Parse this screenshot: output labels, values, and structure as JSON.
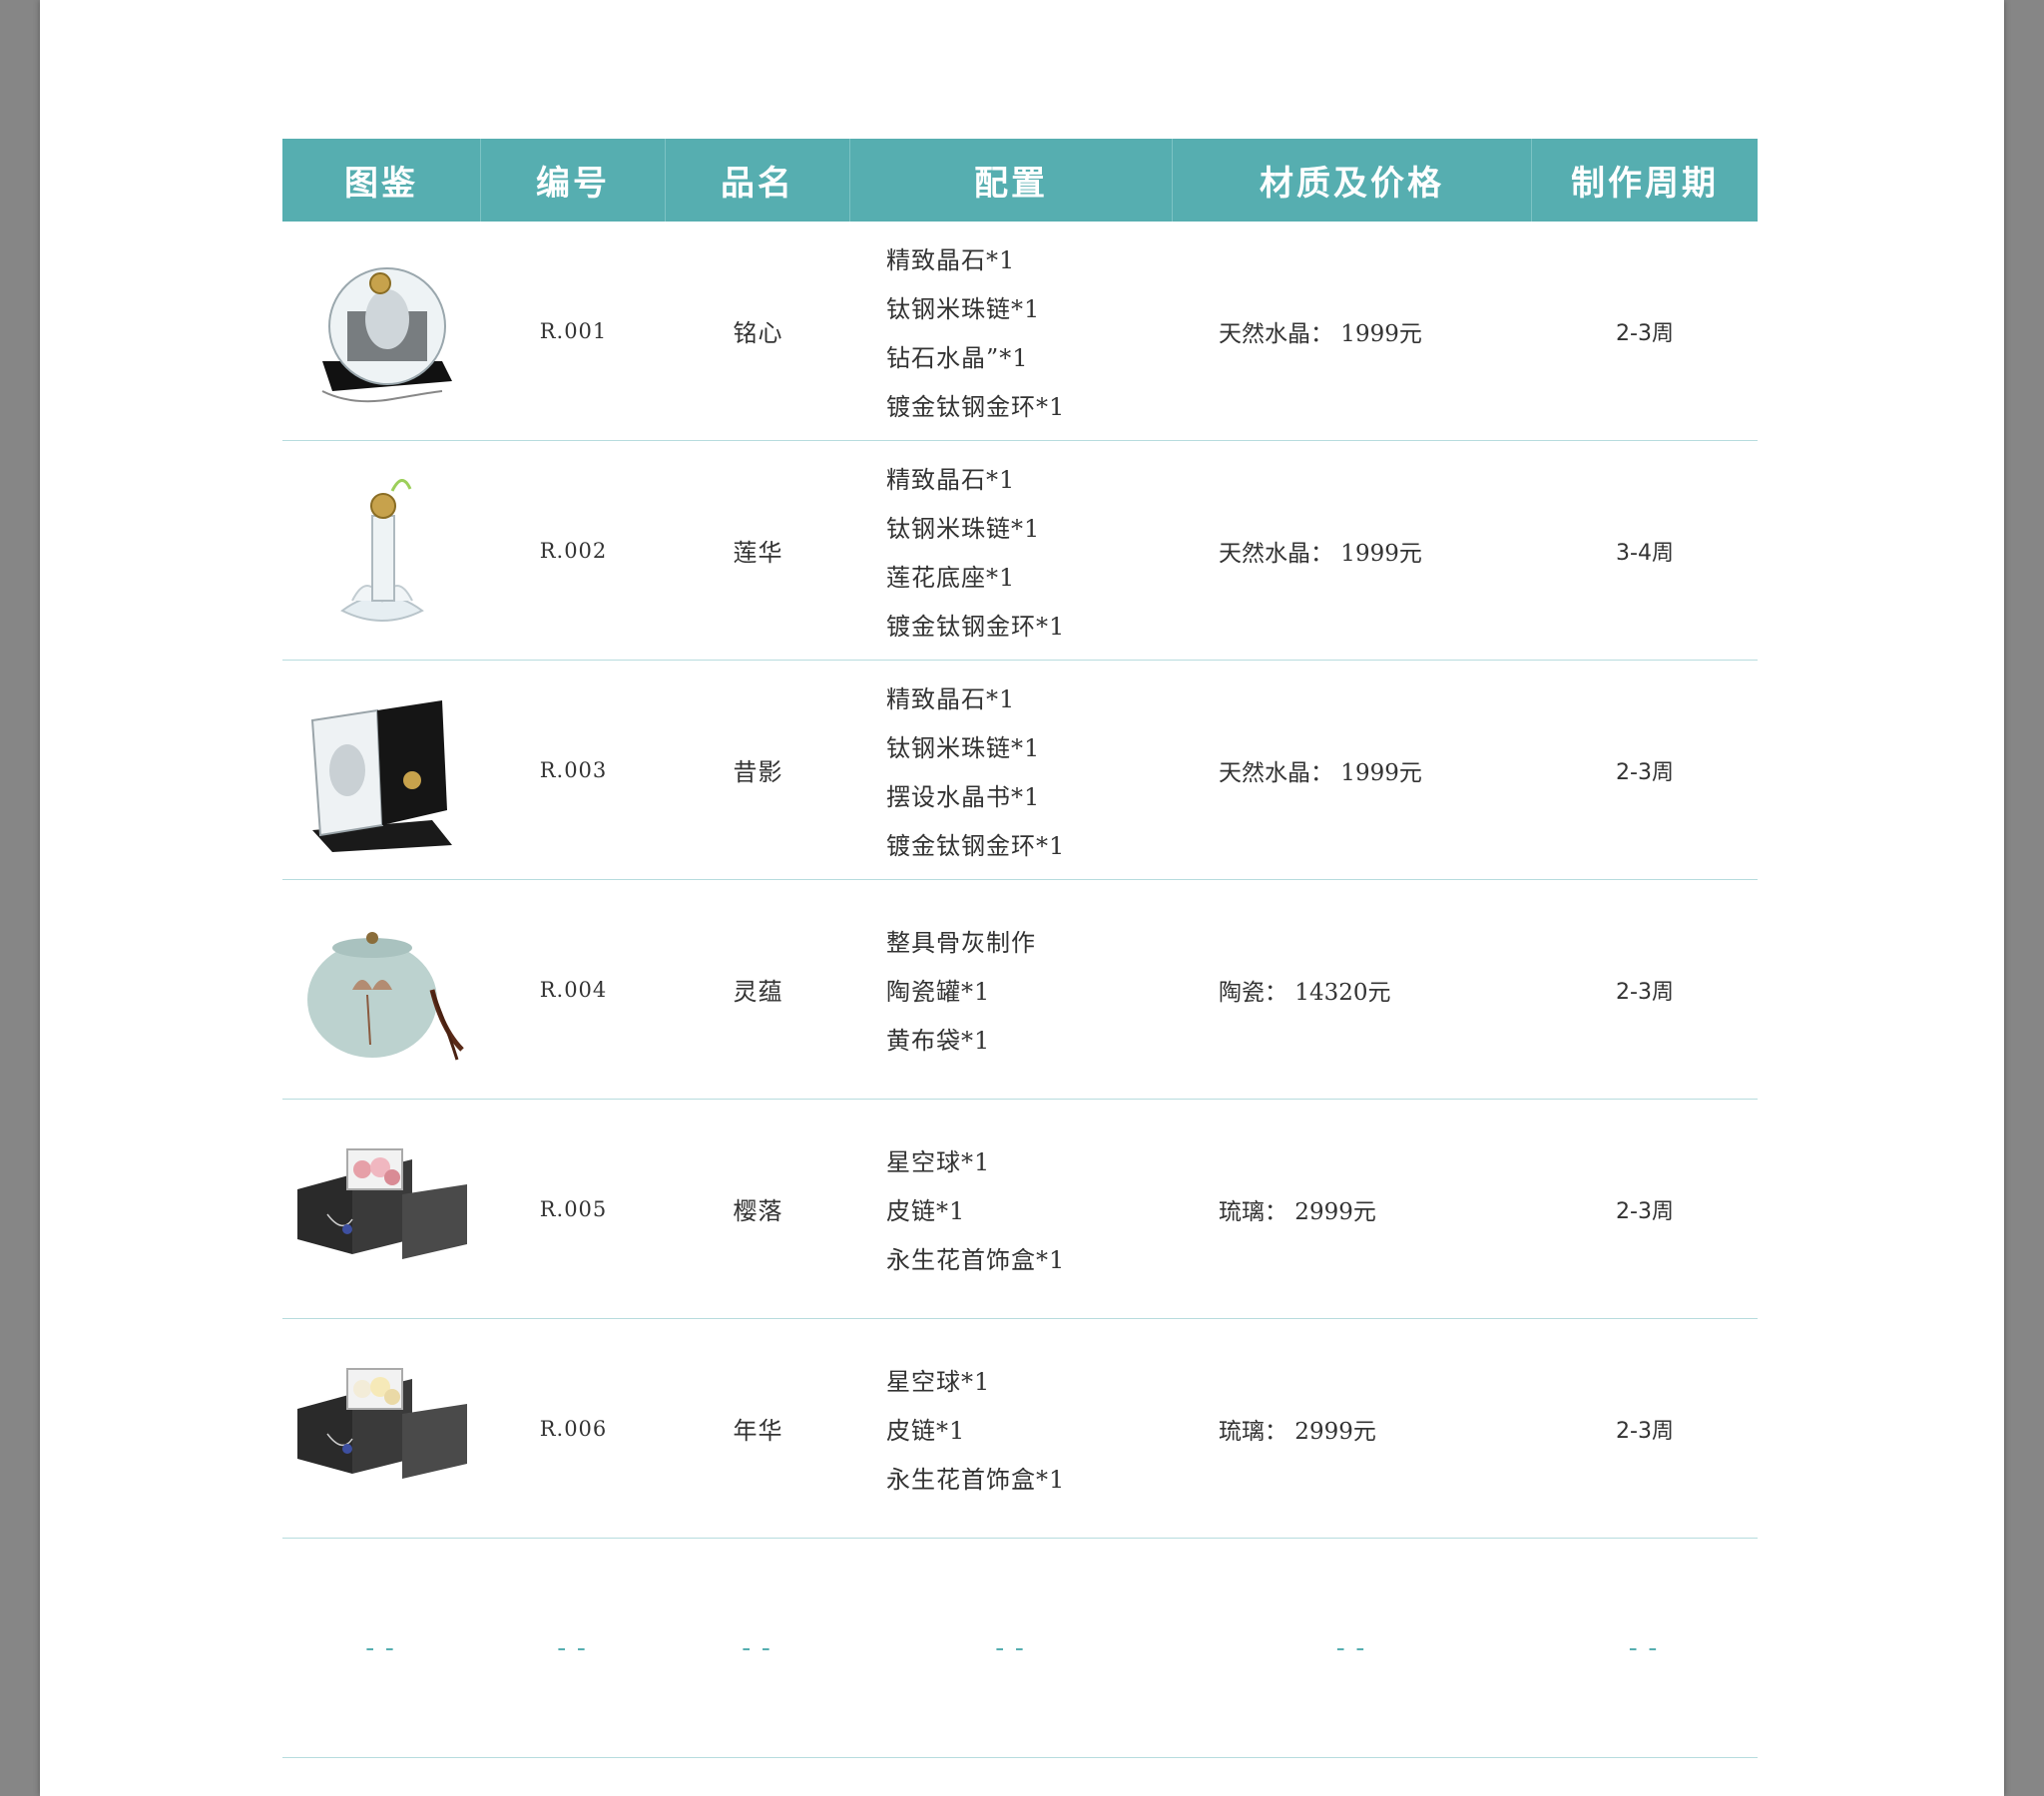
{
  "table": {
    "headers": [
      "图鉴",
      "编号",
      "品名",
      "配置",
      "材质及价格",
      "制作周期"
    ],
    "rows": [
      {
        "thumb_icon": "crystal-sphere-pendant-icon",
        "code": "R.001",
        "name": "铭心",
        "config": [
          "精致晶石*1",
          "钛钢米珠链*1",
          "钻石水晶”*1",
          "镀金钛钢金环*1"
        ],
        "material": "天然水晶： 1999元",
        "period": "2-3周"
      },
      {
        "thumb_icon": "lotus-crystal-stand-icon",
        "code": "R.002",
        "name": "莲华",
        "config": [
          "精致晶石*1",
          "钛钢米珠链*1",
          "莲花底座*1",
          "镀金钛钢金环*1"
        ],
        "material": "天然水晶： 1999元",
        "period": "3-4周"
      },
      {
        "thumb_icon": "crystal-book-display-icon",
        "code": "R.003",
        "name": "昔影",
        "config": [
          "精致晶石*1",
          "钛钢米珠链*1",
          "摆设水晶书*1",
          "镀金钛钢金环*1"
        ],
        "material": "天然水晶： 1999元",
        "period": "2-3周"
      },
      {
        "thumb_icon": "ceramic-jar-icon",
        "code": "R.004",
        "name": "灵蕴",
        "config": [
          "整具骨灰制作",
          "陶瓷罐*1",
          "黄布袋*1"
        ],
        "material": "陶瓷： 14320元",
        "period": "2-3周"
      },
      {
        "thumb_icon": "pink-flower-jewelry-box-icon",
        "code": "R.005",
        "name": "樱落",
        "config": [
          "星空球*1",
          "皮链*1",
          "永生花首饰盒*1"
        ],
        "material": "琉璃： 2999元",
        "period": "2-3周"
      },
      {
        "thumb_icon": "white-flower-jewelry-box-icon",
        "code": "R.006",
        "name": "年华",
        "config": [
          "星空球*1",
          "皮链*1",
          "永生花首饰盒*1"
        ],
        "material": "琉璃： 2999元",
        "period": "2-3周"
      }
    ],
    "empty_row": [
      "--",
      "--",
      "--",
      "--",
      "--",
      "--"
    ]
  },
  "colors": {
    "header_bg": "#56aeb0",
    "divider": "#b7dcde",
    "page_bg": "#ffffff",
    "outer_bg": "#868686"
  }
}
